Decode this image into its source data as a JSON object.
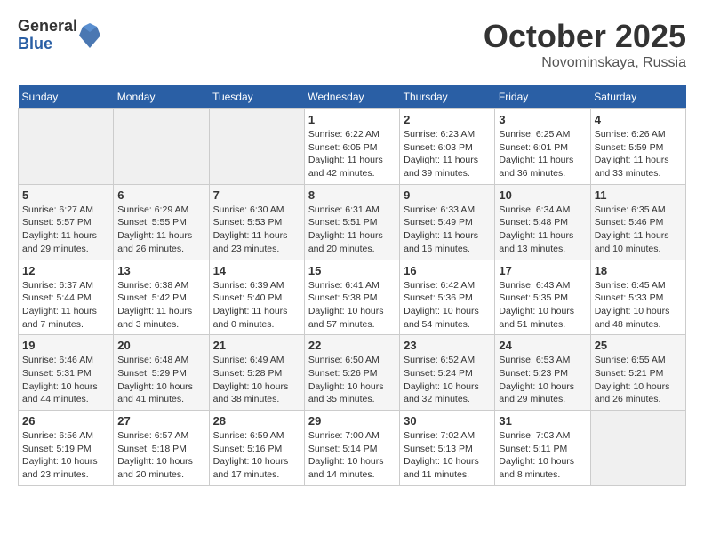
{
  "header": {
    "logo_general": "General",
    "logo_blue": "Blue",
    "month_year": "October 2025",
    "location": "Novominskaya, Russia"
  },
  "weekdays": [
    "Sunday",
    "Monday",
    "Tuesday",
    "Wednesday",
    "Thursday",
    "Friday",
    "Saturday"
  ],
  "weeks": [
    [
      {
        "day": "",
        "info": ""
      },
      {
        "day": "",
        "info": ""
      },
      {
        "day": "",
        "info": ""
      },
      {
        "day": "1",
        "info": "Sunrise: 6:22 AM\nSunset: 6:05 PM\nDaylight: 11 hours\nand 42 minutes."
      },
      {
        "day": "2",
        "info": "Sunrise: 6:23 AM\nSunset: 6:03 PM\nDaylight: 11 hours\nand 39 minutes."
      },
      {
        "day": "3",
        "info": "Sunrise: 6:25 AM\nSunset: 6:01 PM\nDaylight: 11 hours\nand 36 minutes."
      },
      {
        "day": "4",
        "info": "Sunrise: 6:26 AM\nSunset: 5:59 PM\nDaylight: 11 hours\nand 33 minutes."
      }
    ],
    [
      {
        "day": "5",
        "info": "Sunrise: 6:27 AM\nSunset: 5:57 PM\nDaylight: 11 hours\nand 29 minutes."
      },
      {
        "day": "6",
        "info": "Sunrise: 6:29 AM\nSunset: 5:55 PM\nDaylight: 11 hours\nand 26 minutes."
      },
      {
        "day": "7",
        "info": "Sunrise: 6:30 AM\nSunset: 5:53 PM\nDaylight: 11 hours\nand 23 minutes."
      },
      {
        "day": "8",
        "info": "Sunrise: 6:31 AM\nSunset: 5:51 PM\nDaylight: 11 hours\nand 20 minutes."
      },
      {
        "day": "9",
        "info": "Sunrise: 6:33 AM\nSunset: 5:49 PM\nDaylight: 11 hours\nand 16 minutes."
      },
      {
        "day": "10",
        "info": "Sunrise: 6:34 AM\nSunset: 5:48 PM\nDaylight: 11 hours\nand 13 minutes."
      },
      {
        "day": "11",
        "info": "Sunrise: 6:35 AM\nSunset: 5:46 PM\nDaylight: 11 hours\nand 10 minutes."
      }
    ],
    [
      {
        "day": "12",
        "info": "Sunrise: 6:37 AM\nSunset: 5:44 PM\nDaylight: 11 hours\nand 7 minutes."
      },
      {
        "day": "13",
        "info": "Sunrise: 6:38 AM\nSunset: 5:42 PM\nDaylight: 11 hours\nand 3 minutes."
      },
      {
        "day": "14",
        "info": "Sunrise: 6:39 AM\nSunset: 5:40 PM\nDaylight: 11 hours\nand 0 minutes."
      },
      {
        "day": "15",
        "info": "Sunrise: 6:41 AM\nSunset: 5:38 PM\nDaylight: 10 hours\nand 57 minutes."
      },
      {
        "day": "16",
        "info": "Sunrise: 6:42 AM\nSunset: 5:36 PM\nDaylight: 10 hours\nand 54 minutes."
      },
      {
        "day": "17",
        "info": "Sunrise: 6:43 AM\nSunset: 5:35 PM\nDaylight: 10 hours\nand 51 minutes."
      },
      {
        "day": "18",
        "info": "Sunrise: 6:45 AM\nSunset: 5:33 PM\nDaylight: 10 hours\nand 48 minutes."
      }
    ],
    [
      {
        "day": "19",
        "info": "Sunrise: 6:46 AM\nSunset: 5:31 PM\nDaylight: 10 hours\nand 44 minutes."
      },
      {
        "day": "20",
        "info": "Sunrise: 6:48 AM\nSunset: 5:29 PM\nDaylight: 10 hours\nand 41 minutes."
      },
      {
        "day": "21",
        "info": "Sunrise: 6:49 AM\nSunset: 5:28 PM\nDaylight: 10 hours\nand 38 minutes."
      },
      {
        "day": "22",
        "info": "Sunrise: 6:50 AM\nSunset: 5:26 PM\nDaylight: 10 hours\nand 35 minutes."
      },
      {
        "day": "23",
        "info": "Sunrise: 6:52 AM\nSunset: 5:24 PM\nDaylight: 10 hours\nand 32 minutes."
      },
      {
        "day": "24",
        "info": "Sunrise: 6:53 AM\nSunset: 5:23 PM\nDaylight: 10 hours\nand 29 minutes."
      },
      {
        "day": "25",
        "info": "Sunrise: 6:55 AM\nSunset: 5:21 PM\nDaylight: 10 hours\nand 26 minutes."
      }
    ],
    [
      {
        "day": "26",
        "info": "Sunrise: 6:56 AM\nSunset: 5:19 PM\nDaylight: 10 hours\nand 23 minutes."
      },
      {
        "day": "27",
        "info": "Sunrise: 6:57 AM\nSunset: 5:18 PM\nDaylight: 10 hours\nand 20 minutes."
      },
      {
        "day": "28",
        "info": "Sunrise: 6:59 AM\nSunset: 5:16 PM\nDaylight: 10 hours\nand 17 minutes."
      },
      {
        "day": "29",
        "info": "Sunrise: 7:00 AM\nSunset: 5:14 PM\nDaylight: 10 hours\nand 14 minutes."
      },
      {
        "day": "30",
        "info": "Sunrise: 7:02 AM\nSunset: 5:13 PM\nDaylight: 10 hours\nand 11 minutes."
      },
      {
        "day": "31",
        "info": "Sunrise: 7:03 AM\nSunset: 5:11 PM\nDaylight: 10 hours\nand 8 minutes."
      },
      {
        "day": "",
        "info": ""
      }
    ]
  ]
}
